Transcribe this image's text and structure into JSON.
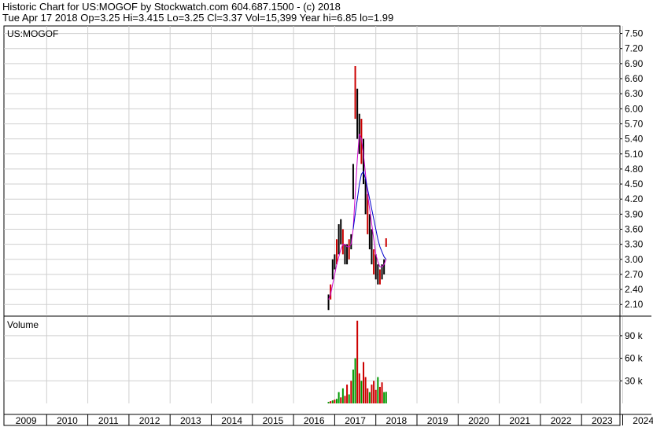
{
  "header": {
    "line1": "Historic Chart for US:MOGOF by Stockwatch.com 604.687.1500 - (c) 2018",
    "line2": "Tue Apr 17 2018  Op=3.25  Hi=3.415  Lo=3.25  Cl=3.37  Vol=15,399  Year hi=6.85  lo=1.99"
  },
  "chart_data": [
    {
      "type": "candlestick",
      "title": "US:MOGOF",
      "ylim": [
        1.9,
        7.65
      ],
      "y_ticks": [
        "7.50",
        "7.20",
        "6.90",
        "6.60",
        "6.30",
        "6.00",
        "5.70",
        "5.40",
        "5.10",
        "4.80",
        "4.50",
        "4.20",
        "3.90",
        "3.60",
        "3.30",
        "3.00",
        "2.70",
        "2.40",
        "2.10"
      ],
      "grid": true,
      "series": [
        {
          "x": [
            2016.85,
            2016.9,
            2016.95,
            2017.0,
            2017.05,
            2017.1,
            2017.15,
            2017.2,
            2017.25,
            2017.3,
            2017.35,
            2017.4,
            2017.45,
            2017.5,
            2017.55,
            2017.6,
            2017.65,
            2017.7,
            2017.75,
            2017.8,
            2017.85,
            2017.9,
            2017.95,
            2018.0,
            2018.05,
            2018.1,
            2018.15,
            2018.2,
            2018.25
          ],
          "high": [
            2.3,
            2.5,
            3.0,
            3.1,
            3.4,
            3.7,
            3.8,
            3.6,
            3.3,
            3.3,
            3.4,
            3.5,
            4.9,
            6.85,
            6.4,
            5.9,
            5.8,
            5.4,
            4.6,
            4.3,
            3.9,
            3.6,
            3.2,
            3.1,
            2.9,
            2.8,
            2.9,
            3.0,
            3.42
          ],
          "low": [
            1.99,
            2.2,
            2.6,
            2.8,
            2.9,
            3.1,
            3.3,
            3.1,
            2.9,
            2.9,
            3.0,
            3.2,
            4.2,
            5.8,
            5.4,
            5.1,
            4.9,
            4.5,
            3.9,
            3.5,
            3.2,
            2.9,
            2.7,
            2.6,
            2.5,
            2.5,
            2.6,
            2.7,
            3.25
          ]
        },
        {
          "name": "",
          "color": "#cc00cc",
          "values": [
            2.2,
            2.3,
            2.5,
            2.7,
            2.9,
            3.05,
            3.2,
            3.3,
            3.3,
            3.25,
            3.25,
            3.3,
            3.6,
            4.3,
            5.0,
            5.5,
            5.4,
            5.1,
            4.7,
            4.3,
            4.0,
            3.7,
            3.4,
            3.1,
            2.95,
            2.85,
            2.85,
            2.9,
            3.0
          ]
        },
        {
          "name": "",
          "color": "#0000cc",
          "values": [
            null,
            null,
            null,
            null,
            null,
            null,
            null,
            null,
            null,
            null,
            null,
            null,
            3.6,
            3.9,
            4.2,
            4.5,
            4.7,
            4.75,
            4.6,
            4.4,
            4.2,
            4.0,
            3.8,
            3.6,
            3.4,
            3.25,
            3.15,
            3.05,
            3.0
          ]
        }
      ]
    },
    {
      "type": "bar",
      "title": "Volume",
      "ylim": [
        0,
        115000
      ],
      "y_ticks": [
        "90 k",
        "60 k",
        "30 k"
      ],
      "x": [
        2016.85,
        2016.9,
        2016.95,
        2017.0,
        2017.05,
        2017.1,
        2017.15,
        2017.2,
        2017.25,
        2017.3,
        2017.35,
        2017.4,
        2017.45,
        2017.5,
        2017.55,
        2017.6,
        2017.65,
        2017.7,
        2017.75,
        2017.8,
        2017.85,
        2017.9,
        2017.95,
        2018.0,
        2018.05,
        2018.1,
        2018.15,
        2018.2,
        2018.25
      ],
      "values": [
        2000,
        3000,
        4000,
        5000,
        6000,
        15000,
        8000,
        20000,
        10000,
        25000,
        12000,
        30000,
        45000,
        60000,
        110000,
        40000,
        30000,
        55000,
        35000,
        20000,
        15000,
        25000,
        30000,
        18000,
        35000,
        22000,
        28000,
        15000,
        15399
      ],
      "colors": [
        "#009900",
        "#cc0000",
        "#009900",
        "#cc0000",
        "#009900",
        "#009900",
        "#cc0000",
        "#009900",
        "#cc0000",
        "#cc0000",
        "#009900",
        "#cc0000",
        "#009900",
        "#009900",
        "#cc0000",
        "#cc0000",
        "#009900",
        "#cc0000",
        "#cc0000",
        "#cc0000",
        "#009900",
        "#cc0000",
        "#cc0000",
        "#cc0000",
        "#009900",
        "#cc0000",
        "#cc0000",
        "#009900",
        "#009900"
      ]
    }
  ],
  "x_axis_labels": [
    "2009",
    "2010",
    "2011",
    "2012",
    "2013",
    "2014",
    "2015",
    "2016",
    "2017",
    "2018",
    "2019",
    "2020",
    "2021",
    "2022",
    "2023",
    "2024"
  ]
}
